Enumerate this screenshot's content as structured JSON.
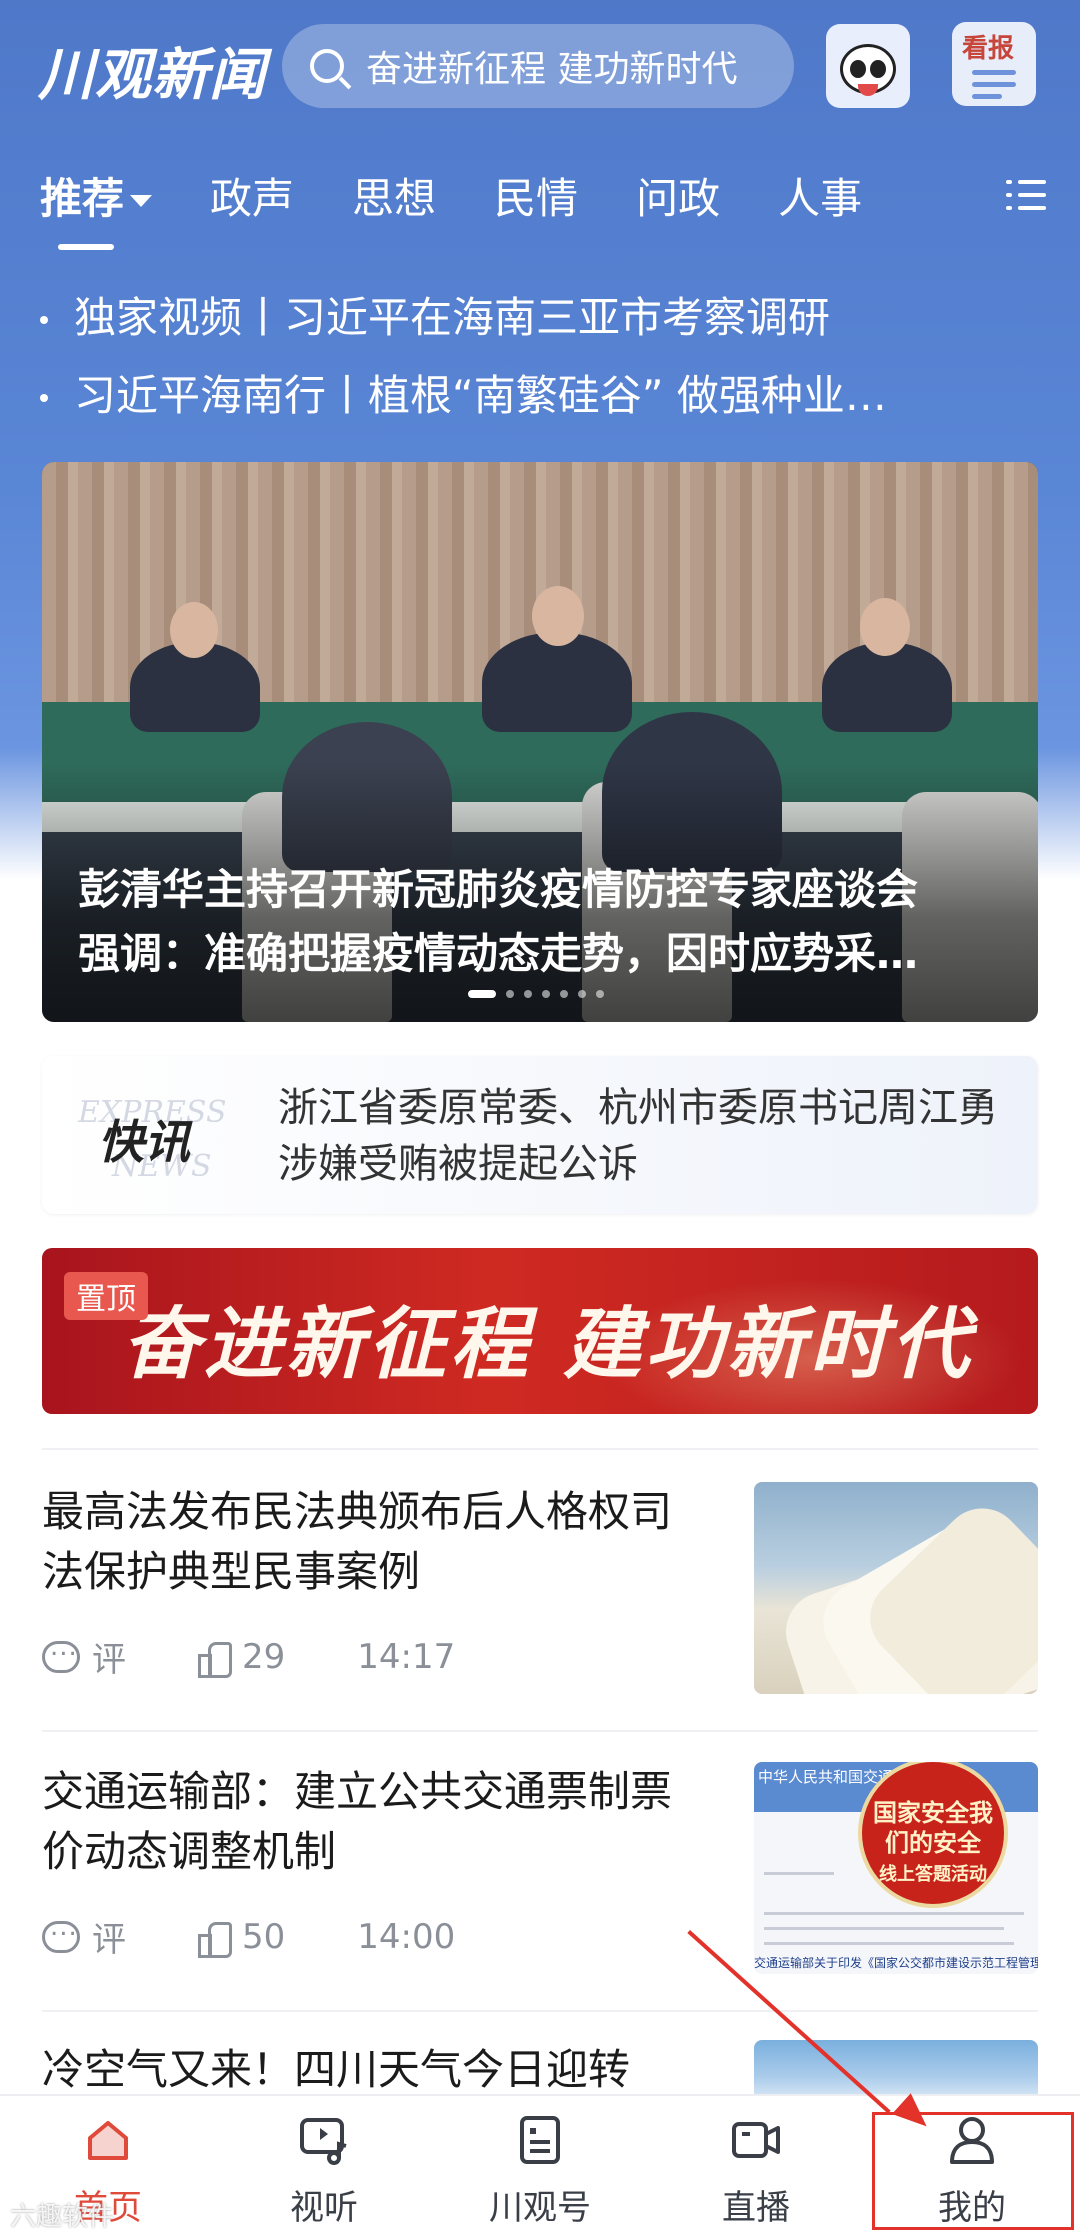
{
  "header": {
    "logo": "川观新闻",
    "search_placeholder": "奋进新征程  建功新时代",
    "kanbao_label": "看报"
  },
  "tabs": [
    {
      "label": "推荐",
      "active": true
    },
    {
      "label": "政声"
    },
    {
      "label": "思想"
    },
    {
      "label": "民情"
    },
    {
      "label": "问政"
    },
    {
      "label": "人事"
    }
  ],
  "headlines": [
    "独家视频丨习近平在海南三亚市考察调研",
    "习近平海南行丨植根“南繁硅谷”  做强种业…"
  ],
  "carousel": {
    "title_line1": "彭清华主持召开新冠肺炎疫情防控专家座谈会",
    "title_line2": "强调：准确把握疫情动态走势，因时应势采…",
    "slide_count": 7,
    "active_index": 0
  },
  "express": {
    "bg_text_1": "EXPRESS",
    "bg_text_2": "NEWS",
    "label": "快讯",
    "text": "浙江省委原常委、杭州市委原书记周江勇涉嫌受贿被提起公诉"
  },
  "banner": {
    "pin_label": "置顶",
    "text": "奋进新征程 建功新时代"
  },
  "news": [
    {
      "title": "最高法发布民法典颁布后人格权司法保护典型民事案例",
      "comment_label": "评",
      "likes": "29",
      "time": "14:17"
    },
    {
      "title": "交通运输部：建立公共交通票制票价动态调整机制",
      "comment_label": "评",
      "likes": "50",
      "time": "14:00",
      "thumb_header": "中华人民共和国交通运输部",
      "thumb_badge": "国家安全我们的安全",
      "thumb_badge_sub": "线上答题活动",
      "thumb_caption": "交通运输部关于印发《国家公交都市建设示范工程管理办法》的通知"
    },
    {
      "title": "冷空气又来！四川天气今日迎转"
    }
  ],
  "bottom_nav": [
    {
      "label": "首页",
      "icon": "home-icon",
      "active": true
    },
    {
      "label": "视听",
      "icon": "video-music-icon"
    },
    {
      "label": "川观号",
      "icon": "account-card-icon"
    },
    {
      "label": "直播",
      "icon": "live-camera-icon"
    },
    {
      "label": "我的",
      "icon": "user-icon"
    }
  ],
  "watermark": "六趣软件",
  "colors": {
    "brand_blue": "#5a86d6",
    "accent_red": "#e04a3a",
    "annotation_red": "#e2322a"
  }
}
